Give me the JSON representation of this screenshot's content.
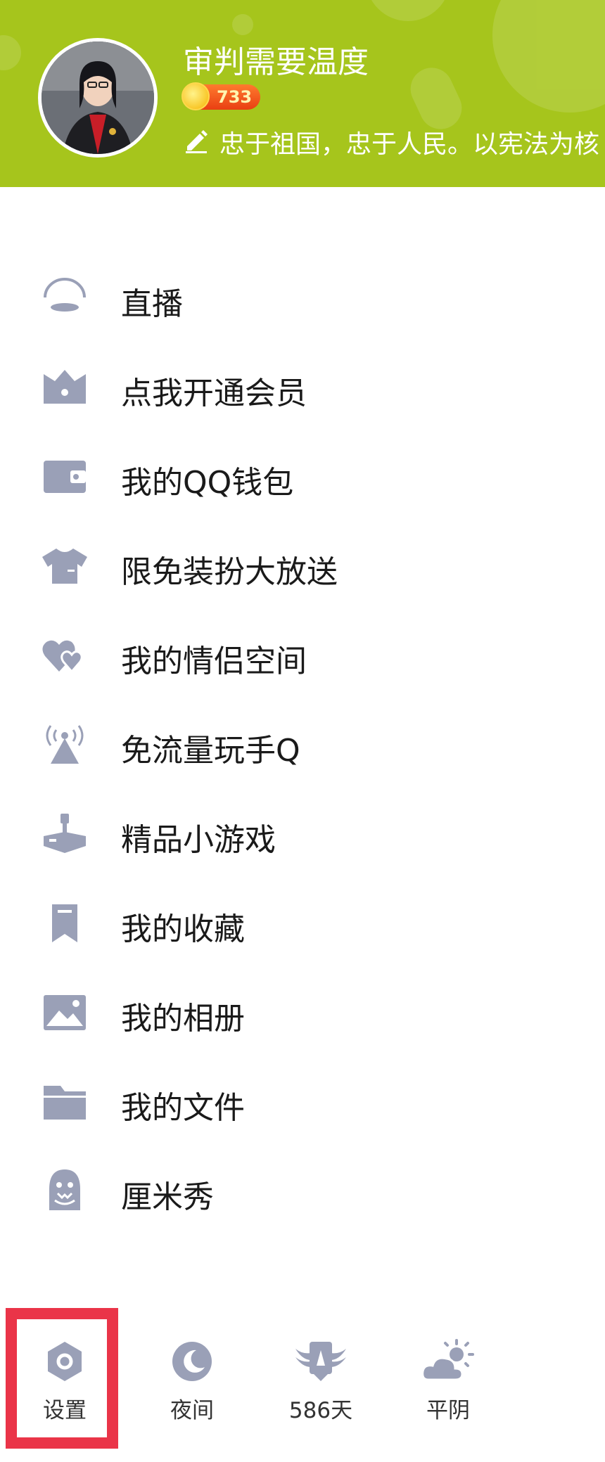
{
  "profile": {
    "username": "审判需要温度",
    "level": "733",
    "signature": "忠于祖国，忠于人民。以宪法为核"
  },
  "colors": {
    "header_bg": "#a6c51c",
    "icon": "#9aa0b7",
    "highlight": "#ea3448"
  },
  "menu": {
    "items": [
      {
        "label": "直播",
        "icon": "live-icon"
      },
      {
        "label": "点我开通会员",
        "icon": "vip-crown-icon"
      },
      {
        "label": "我的QQ钱包",
        "icon": "wallet-icon"
      },
      {
        "label": "限免装扮大放送",
        "icon": "tshirt-icon"
      },
      {
        "label": "我的情侣空间",
        "icon": "double-heart-icon"
      },
      {
        "label": "免流量玩手Q",
        "icon": "signal-tower-icon"
      },
      {
        "label": "精品小游戏",
        "icon": "joystick-icon"
      },
      {
        "label": "我的收藏",
        "icon": "bookmark-icon"
      },
      {
        "label": "我的相册",
        "icon": "photo-icon"
      },
      {
        "label": "我的文件",
        "icon": "folder-icon"
      },
      {
        "label": "厘米秀",
        "icon": "cmshow-ghost-icon"
      }
    ]
  },
  "bottom_bar": {
    "settings": "设置",
    "night": "夜间",
    "days": "586天",
    "weather": "平阴"
  }
}
